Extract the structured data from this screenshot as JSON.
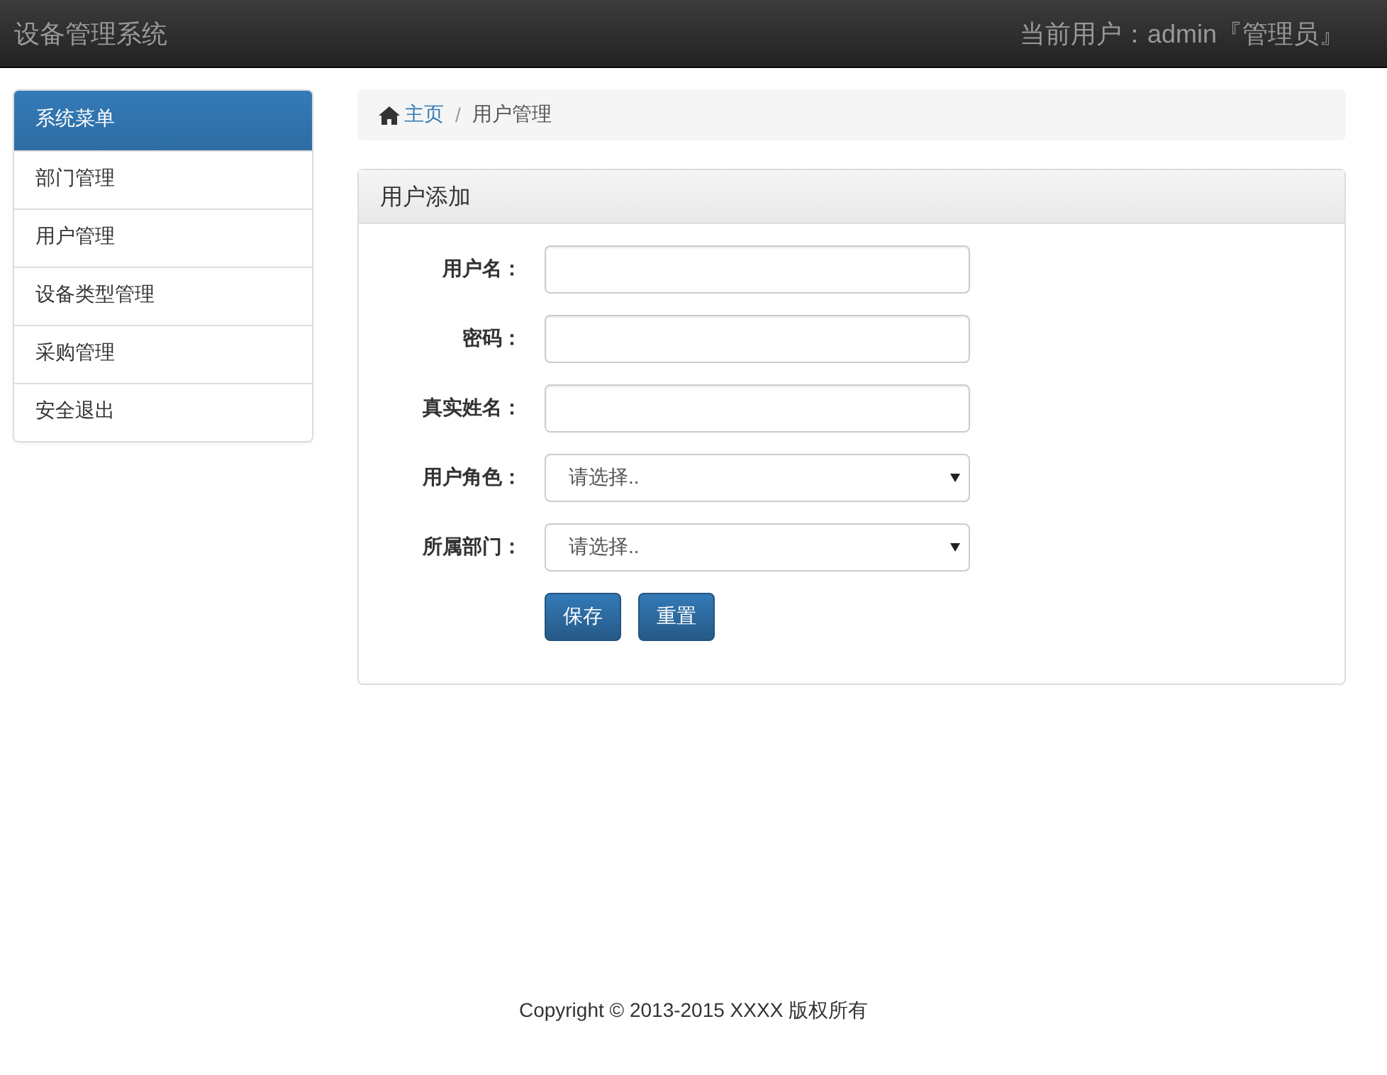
{
  "navbar": {
    "title": "设备管理系统",
    "user": "当前用户：admin『管理员』"
  },
  "sidebar": {
    "heading": "系统菜单",
    "items": [
      {
        "label": "部门管理"
      },
      {
        "label": "用户管理"
      },
      {
        "label": "设备类型管理"
      },
      {
        "label": "采购管理"
      },
      {
        "label": "安全退出"
      }
    ]
  },
  "breadcrumb": [
    {
      "label": "主页",
      "kind": "link"
    },
    {
      "label": "/",
      "kind": "separator"
    },
    {
      "label": "用户管理",
      "kind": "current"
    }
  ],
  "panel": {
    "title": "用户添加",
    "fields": [
      {
        "label": "用户名：",
        "kind": "text"
      },
      {
        "label": "密码：",
        "kind": "text"
      },
      {
        "label": "真实姓名：",
        "kind": "text"
      },
      {
        "label": "用户角色：",
        "kind": "select",
        "value": "请选择.."
      },
      {
        "label": "所属部门：",
        "kind": "select",
        "value": "请选择.."
      }
    ],
    "buttons": [
      "保存",
      "重置"
    ]
  },
  "footer": "Copyright © 2013-2015 XXXX 版权所有"
}
